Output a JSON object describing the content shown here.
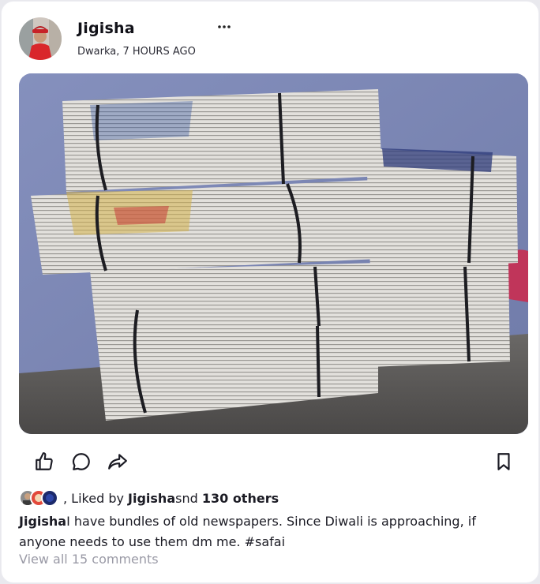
{
  "post": {
    "username": "Jigisha",
    "location": "Dwarka",
    "time": "7 HOURS AGO",
    "meta_text": "Dwarka, 7 HOURS AGO",
    "more_label": "···",
    "image_icon": "newspaper-bundles-photo"
  },
  "actions": {
    "like_icon": "thumbs-up-icon",
    "comment_icon": "comment-icon",
    "share_icon": "share-icon",
    "save_icon": "bookmark-icon"
  },
  "likes": {
    "prefix": ", Liked by ",
    "liker": "Jigisha",
    "mid": "snd ",
    "others": "130 others"
  },
  "caption": {
    "author": "Jigisha",
    "text": "I have bundles of old newspapers. Since Diwali is approaching, if anyone needs to use them dm me. #safai"
  },
  "comments": {
    "view_all": "View all 15 comments"
  },
  "colors": {
    "accent_red": "#d9262b",
    "muted_text": "#9a9aa6",
    "wall": "#7b87b4",
    "shelf": "#5a5a5c"
  }
}
